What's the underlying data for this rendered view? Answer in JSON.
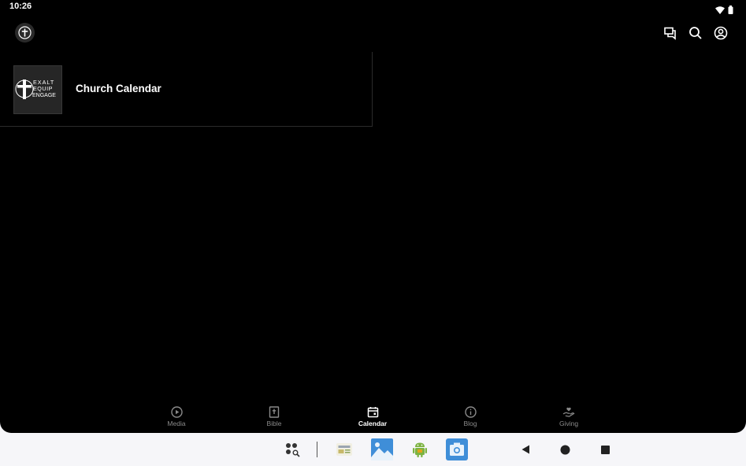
{
  "status_bar": {
    "time": "10:26",
    "icons": [
      "wifi-icon",
      "battery-icon"
    ]
  },
  "app_bar": {
    "logo": "cross-logo-icon",
    "actions": [
      "chat-icon",
      "search-icon",
      "account-icon"
    ]
  },
  "list": {
    "items": [
      {
        "title": "Church Calendar",
        "thumbnail_text": [
          "Exalt",
          "Equip",
          "Engage"
        ]
      }
    ]
  },
  "bottom_nav": {
    "items": [
      {
        "label": "Media",
        "icon": "play-circle-icon"
      },
      {
        "label": "Bible",
        "icon": "bible-icon"
      },
      {
        "label": "Calendar",
        "icon": "calendar-icon",
        "active": true
      },
      {
        "label": "Blog",
        "icon": "info-icon"
      },
      {
        "label": "Giving",
        "icon": "giving-hand-icon"
      }
    ]
  },
  "system_bar": {
    "apps": [
      "app-drawer-search-icon",
      "news-app-icon",
      "photos-app-icon",
      "android-app-icon",
      "camera-app-icon"
    ],
    "nav": [
      "back-icon",
      "home-icon",
      "recents-icon"
    ]
  },
  "colors": {
    "background": "#000000",
    "text": "#ffffff",
    "inactive": "#8a8a8a",
    "system_bar": "#f6f6f9"
  }
}
